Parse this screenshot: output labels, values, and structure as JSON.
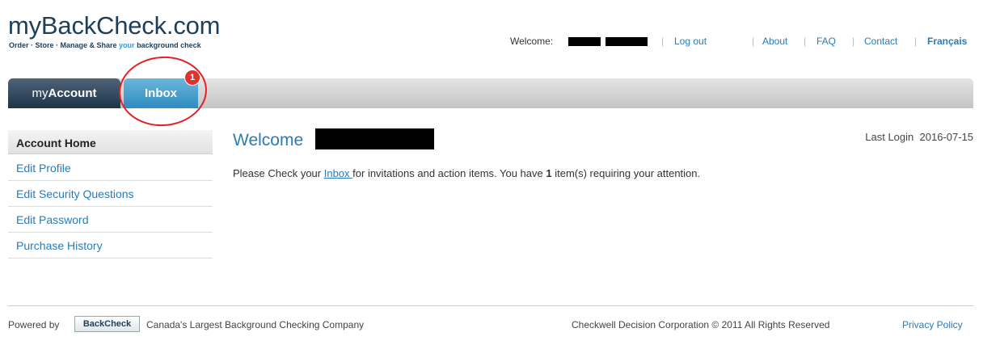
{
  "logo": {
    "main": "myBackCheck.com",
    "tagline_pre": "Order · Store · Manage & Share ",
    "tagline_highlight": "your",
    "tagline_post": " background check"
  },
  "topnav": {
    "welcome_label": "Welcome:",
    "logout": "Log out",
    "about": "About",
    "faq": "FAQ",
    "contact": "Contact",
    "language": "Français"
  },
  "tabs": {
    "account_prefix": "my",
    "account_main": "Account",
    "inbox": "Inbox",
    "inbox_badge": "1"
  },
  "sidebar": {
    "header": "Account Home",
    "items": [
      {
        "label": "Edit Profile"
      },
      {
        "label": "Edit Security Questions"
      },
      {
        "label": "Edit Password"
      },
      {
        "label": "Purchase History"
      }
    ]
  },
  "main": {
    "welcome": "Welcome",
    "last_login_label": "Last Login",
    "last_login_date": "2016-07-15",
    "msg_pre": "Please Check your ",
    "msg_link": "Inbox ",
    "msg_mid": "for invitations and action items. You have ",
    "msg_count": "1",
    "msg_post": " item(s) requiring your attention."
  },
  "footer": {
    "powered_by": "Powered by",
    "backcheck_logo": "BackCheck",
    "company_desc": "Canada's Largest Background Checking Company",
    "copyright": "Checkwell Decision Corporation © 2011 All Rights Reserved",
    "privacy": "Privacy Policy"
  },
  "colors": {
    "brand_dark": "#1e3f5a",
    "link_blue": "#2a7bb6",
    "badge_red": "#e0322b",
    "highlight_circle": "#e42025"
  }
}
